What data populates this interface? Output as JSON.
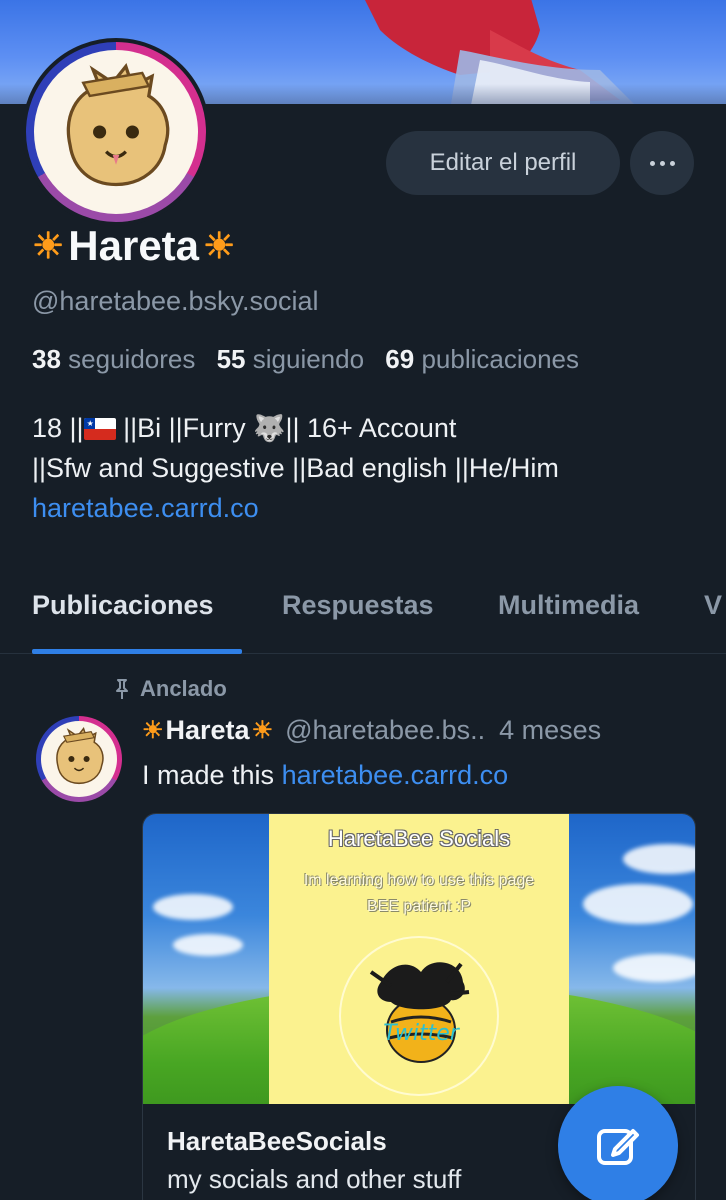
{
  "header": {
    "edit_profile_label": "Editar el perfil",
    "more_label": "···"
  },
  "profile": {
    "display_name": "Hareta",
    "handle": "@haretabee.bsky.social",
    "sun_glyph": "☀",
    "stats": {
      "followers_count": "38",
      "followers_label": "seguidores",
      "following_count": "55",
      "following_label": "siguiendo",
      "posts_count": "69",
      "posts_label": "publicaciones"
    },
    "bio": {
      "line1_a": "18 ||",
      "line1_b": " ||Bi ||Furry ",
      "line1_c": "|| 16+ Account",
      "line2": "||Sfw and Suggestive ||Bad english ||He/Him",
      "link": "haretabee.carrd.co"
    }
  },
  "tabs": [
    "Publicaciones",
    "Respuestas",
    "Multimedia",
    "V"
  ],
  "active_tab": "Publicaciones",
  "post": {
    "pinned_label": "Anclado",
    "author_name": "Hareta",
    "author_handle": "@haretabee.bs..",
    "time": "4 meses",
    "text_prefix": "I made this ",
    "text_link": "haretabee.carrd.co",
    "card": {
      "image_title": "HaretaBee Socials",
      "image_subtitle": "Im learning how to use this page BEE patient :P",
      "image_badge": "Twitter",
      "title": "HaretaBeeSocials",
      "description": "my socials and other stuff"
    }
  },
  "colors": {
    "background": "#161e27",
    "accent": "#2f7fe6",
    "link": "#3d8ef0",
    "muted_text": "#8b98a7",
    "sun": "#ff9c1a"
  },
  "icons": [
    "more-dots-icon",
    "sun-icon",
    "chile-flag-icon",
    "wolf-icon",
    "pin-icon",
    "compose-icon"
  ]
}
